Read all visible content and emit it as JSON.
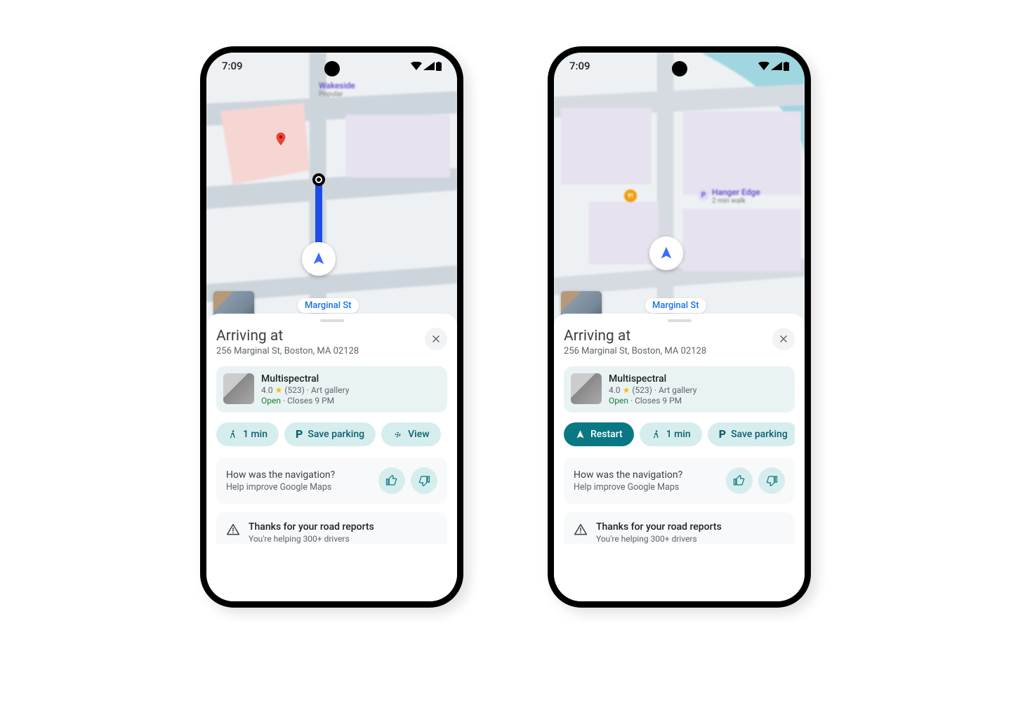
{
  "status": {
    "time": "7:09"
  },
  "map": {
    "street_label": "Marginal St",
    "poi_right": {
      "name": "Hanger Edge",
      "sub": "2 min walk"
    },
    "poi_top": {
      "name": "Wakeside",
      "sub": "Popular"
    }
  },
  "sheet": {
    "title": "Arriving at",
    "address": "256 Marginal St, Boston, MA 02128",
    "place": {
      "name": "Multispectral",
      "rating": "4.0",
      "reviews": "(523)",
      "category": "Art gallery",
      "open": "Open",
      "closes": "Closes 9 PM"
    }
  },
  "chips_left": {
    "walk": "1 min",
    "parking": "Save parking",
    "view": "View"
  },
  "chips_right": {
    "restart": "Restart",
    "walk": "1 min",
    "parking": "Save parking"
  },
  "feedback": {
    "title": "How was the navigation?",
    "sub": "Help improve Google Maps"
  },
  "report": {
    "title": "Thanks for your road reports",
    "sub": "You're helping 300+ drivers"
  }
}
